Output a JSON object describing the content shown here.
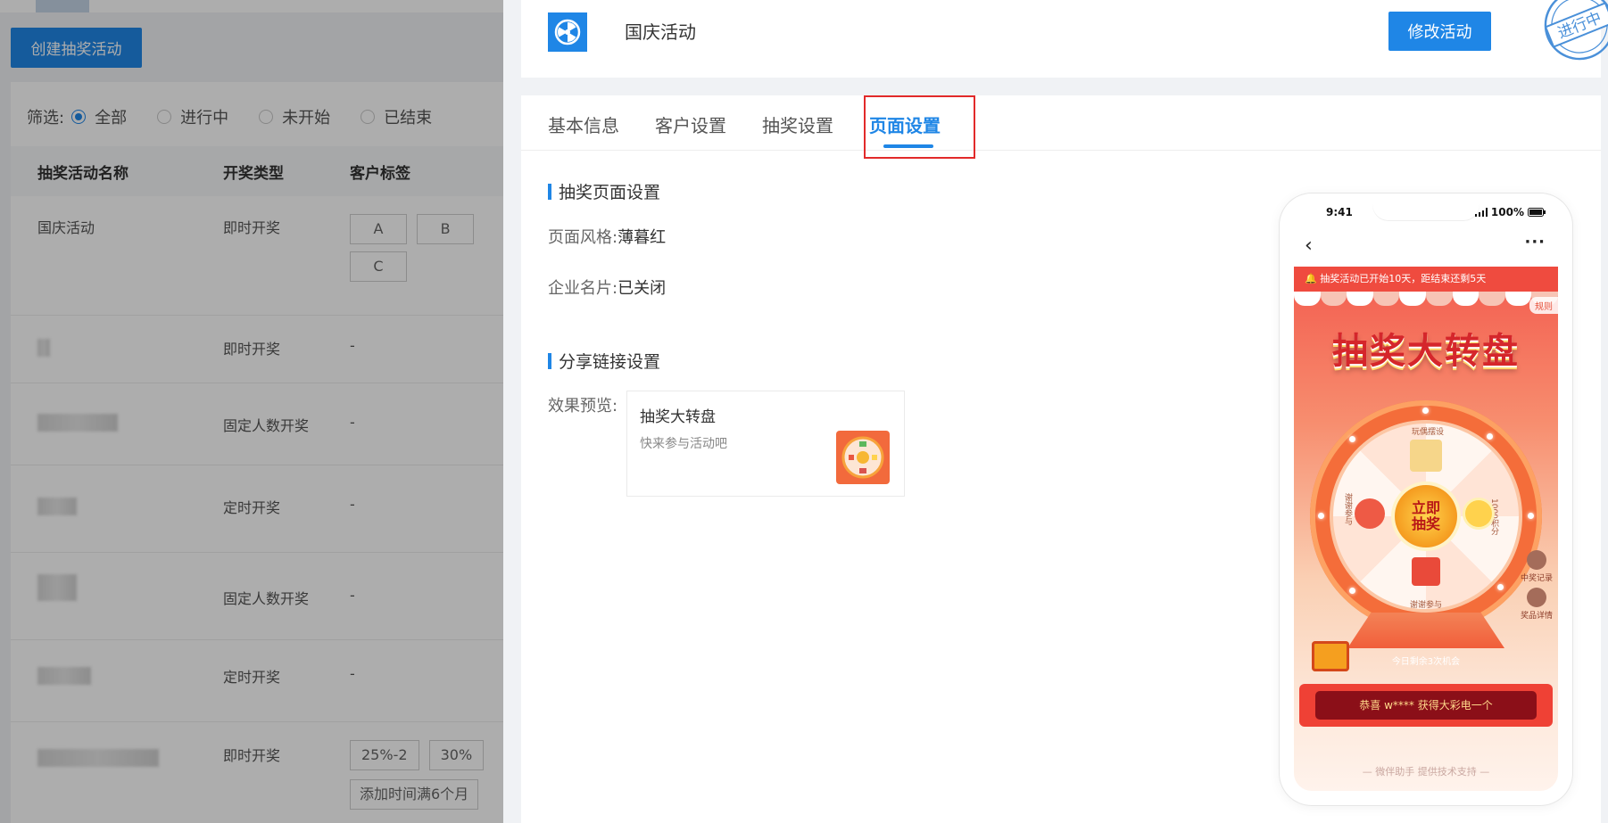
{
  "background": {
    "create_button": "创建抽奖活动",
    "filter": {
      "label": "筛选:",
      "options": [
        "全部",
        "进行中",
        "未开始",
        "已结束"
      ],
      "selected": "全部"
    },
    "table": {
      "headers": [
        "抽奖活动名称",
        "开奖类型",
        "客户标签"
      ],
      "rows": [
        {
          "name": "国庆活动",
          "type": "即时开奖",
          "tags": [
            "A",
            "B",
            "C"
          ]
        },
        {
          "name": "",
          "type": "即时开奖",
          "tags": [
            "-"
          ]
        },
        {
          "name": "",
          "type": "固定人数开奖",
          "tags": [
            "-"
          ]
        },
        {
          "name": "",
          "type": "定时开奖",
          "tags": [
            "-"
          ]
        },
        {
          "name": "",
          "type": "固定人数开奖",
          "tags": [
            "-"
          ]
        },
        {
          "name": "",
          "type": "定时开奖",
          "tags": [
            "-"
          ]
        },
        {
          "name": "",
          "type": "即时开奖",
          "tags": [
            "25%-2",
            "30%",
            "添加时间满6个月"
          ]
        }
      ]
    }
  },
  "drawer": {
    "activity_title": "国庆活动",
    "edit_button": "修改活动",
    "stamp_text": "进行中",
    "tabs": [
      "基本信息",
      "客户设置",
      "抽奖设置",
      "页面设置"
    ],
    "active_tab": "页面设置",
    "page_section": {
      "title": "抽奖页面设置",
      "style_label": "页面风格:",
      "style_value": "薄暮红",
      "card_label": "企业名片:",
      "card_value": "已关闭"
    },
    "share_section": {
      "title": "分享链接设置",
      "preview_label": "效果预览:",
      "card_title": "抽奖大转盘",
      "card_subtitle": "快来参与活动吧"
    }
  },
  "phone": {
    "time": "9:41",
    "battery": "100%",
    "notice": "抽奖活动已开始10天，距结束还剩5天",
    "rule": "规则",
    "headline": "抽奖大转盘",
    "center_button": [
      "立即",
      "抽奖"
    ],
    "prizes": [
      "玩偶摆设",
      "1000积分",
      "谢谢参与",
      "谢谢参与"
    ],
    "remaining": "今日剩余3次机会",
    "side_my": "中奖记录",
    "side_prize": "奖品详情",
    "winner": "恭喜 w**** 获得大彩电一个",
    "footer": "— 微伴助手 提供技术支持 —"
  },
  "colors": {
    "primary": "#1f86e6",
    "highlight_box": "#e22a2a",
    "lottery_red": "#ef4b3f"
  }
}
